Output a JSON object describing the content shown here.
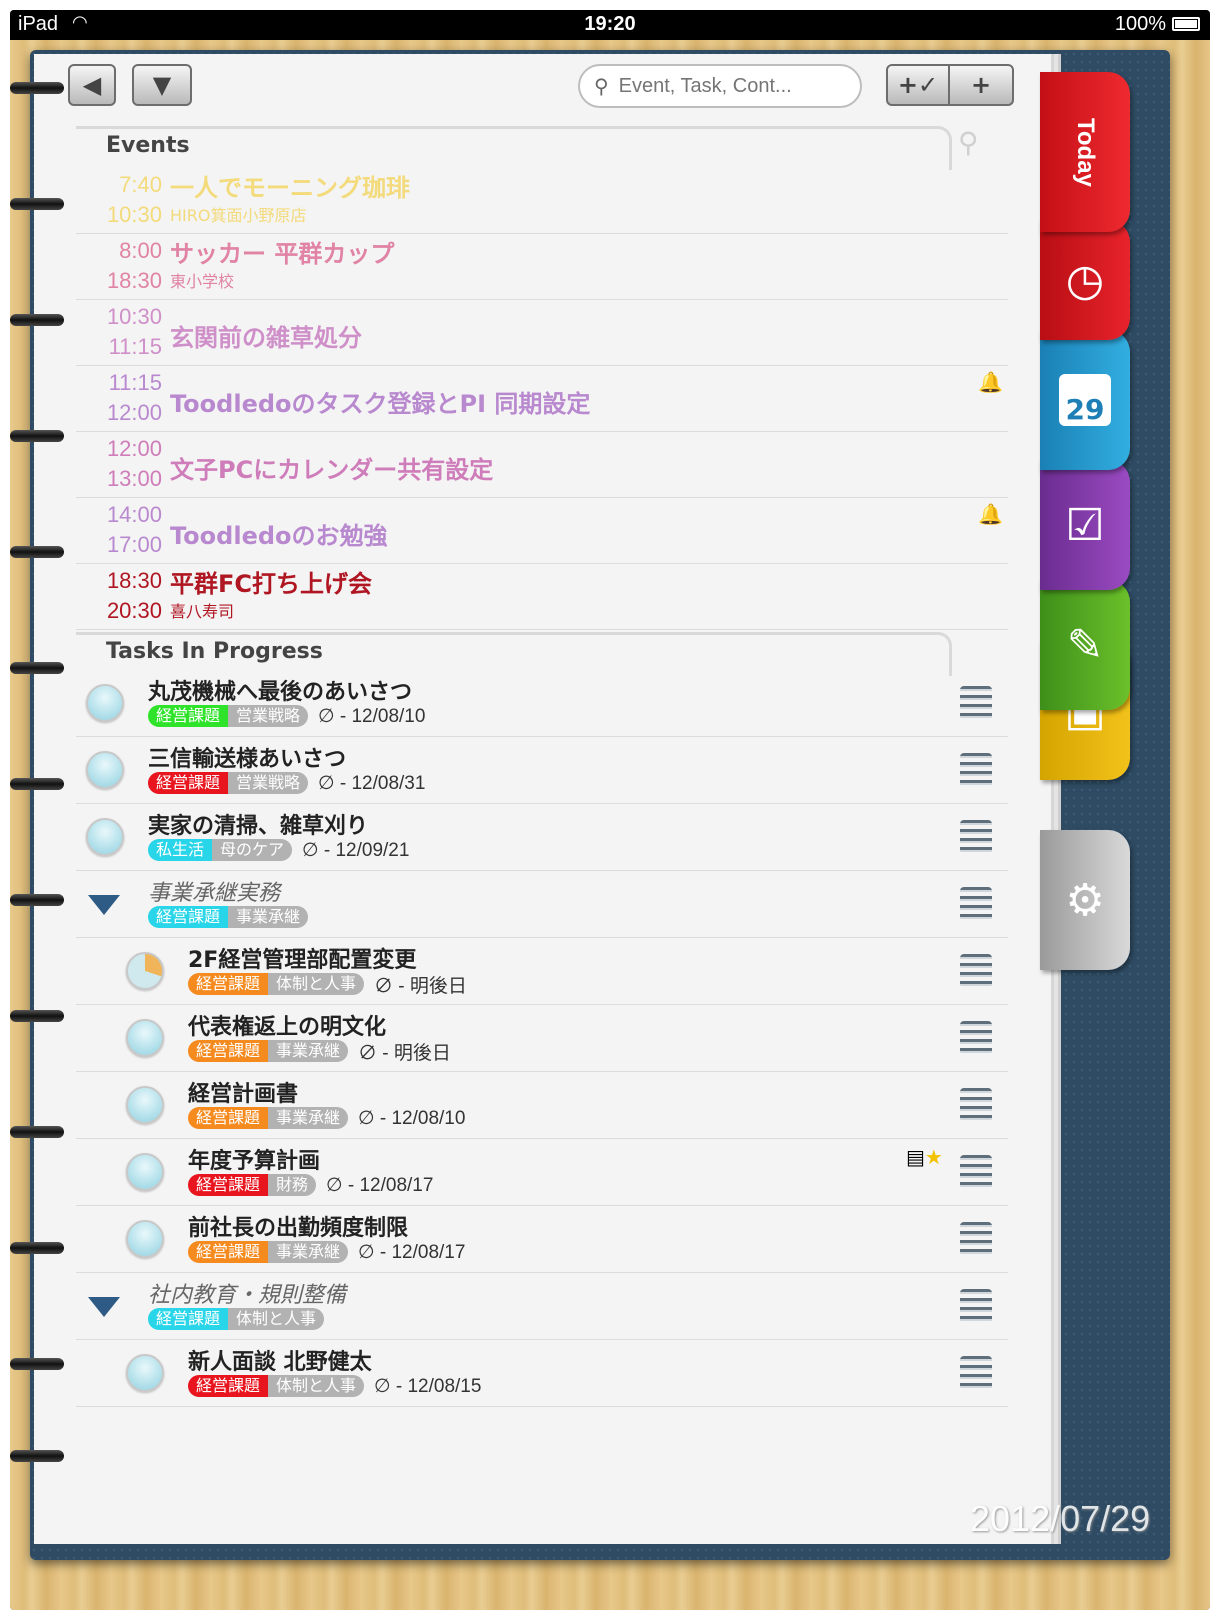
{
  "status_bar": {
    "carrier": "iPad",
    "time": "19:20",
    "battery": "100%"
  },
  "toolbar": {
    "search_placeholder": "Event, Task, Cont..."
  },
  "sections": {
    "events": "Events",
    "tasks": "Tasks In Progress"
  },
  "events": [
    {
      "start": "7:40",
      "end": "10:30",
      "title": "一人でモーニング珈琲",
      "location": "HIRO箕面小野原店",
      "color": "#f3da7a"
    },
    {
      "start": "8:00",
      "end": "18:30",
      "title": "サッカー 平群カップ",
      "location": "東小学校",
      "color": "#e083a4"
    },
    {
      "start": "10:30",
      "end": "11:15",
      "title": "玄関前の雑草処分",
      "location": "",
      "color": "#cf8fc9"
    },
    {
      "start": "11:15",
      "end": "12:00",
      "title": "Toodledoのタスク登録とPI 同期設定",
      "location": "",
      "color": "#b989cf"
    },
    {
      "start": "12:00",
      "end": "13:00",
      "title": "文子PCにカレンダー共有設定",
      "location": "",
      "color": "#cf7dba"
    },
    {
      "start": "14:00",
      "end": "17:00",
      "title": "Toodledoのお勉強",
      "location": "",
      "color": "#b989cf"
    },
    {
      "start": "18:30",
      "end": "20:30",
      "title": "平群FC打ち上げ会",
      "location": "喜八寿司",
      "color": "#b01622"
    }
  ],
  "tasks": [
    {
      "title": "丸茂機械へ最後のあいさつ",
      "category": "経営課題",
      "subcategory": "営業戦略",
      "category_color": "#2fe32a",
      "due": "∅ - 12/08/10"
    },
    {
      "title": "三信輸送様あいさつ",
      "category": "経営課題",
      "subcategory": "営業戦略",
      "category_color": "#e8141e",
      "due": "∅ - 12/08/31"
    },
    {
      "title": "実家の清掃、雑草刈り",
      "category": "私生活",
      "subcategory": "母のケア",
      "category_color": "#29d5e8",
      "due": "∅ - 12/09/21"
    },
    {
      "title": "事業承継実務",
      "category": "経営課題",
      "subcategory": "事業承継",
      "category_color": "#29d5e8",
      "due": ""
    },
    {
      "title": "2F経営管理部配置変更",
      "category": "経営課題",
      "subcategory": "体制と人事",
      "category_color": "#f58a1f",
      "due": "∅ - 明後日"
    },
    {
      "title": "代表権返上の明文化",
      "category": "経営課題",
      "subcategory": "事業承継",
      "category_color": "#f58a1f",
      "due": "∅ - 明後日"
    },
    {
      "title": "経営計画書",
      "category": "経営課題",
      "subcategory": "事業承継",
      "category_color": "#f58a1f",
      "due": "∅ - 12/08/10"
    },
    {
      "title": "年度予算計画",
      "category": "経営課題",
      "subcategory": "財務",
      "category_color": "#e8141e",
      "due": "∅ - 12/08/17"
    },
    {
      "title": "前社長の出勤頻度制限",
      "category": "経営課題",
      "subcategory": "事業承継",
      "category_color": "#f58a1f",
      "due": "∅ - 12/08/17"
    },
    {
      "title": "社内教育・規則整備",
      "category": "経営課題",
      "subcategory": "体制と人事",
      "category_color": "#29d5e8",
      "due": ""
    },
    {
      "title": "新人面談 北野健太",
      "category": "経営課題",
      "subcategory": "体制と人事",
      "category_color": "#e8141e",
      "due": "∅ - 12/08/15"
    }
  ],
  "side_tabs": {
    "today": "Today",
    "calendar_day": "29"
  },
  "photo_date": "2012/07/29"
}
